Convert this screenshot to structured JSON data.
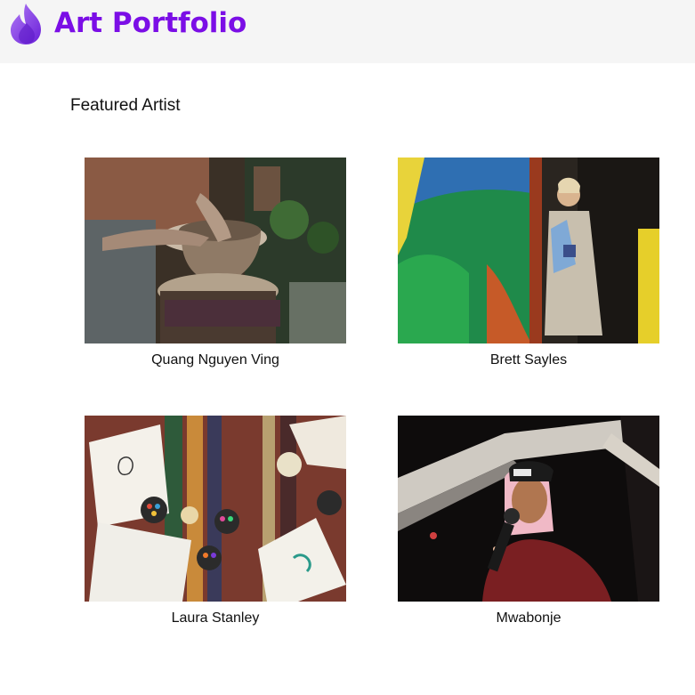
{
  "header": {
    "brand": "Art Portfolio",
    "logo_icon": "flame-icon",
    "brand_color": "#7b0ee6",
    "background": "#f5f5f5"
  },
  "section": {
    "title": "Featured Artist"
  },
  "artists": [
    {
      "name": "Quang Nguyen Ving"
    },
    {
      "name": "Brett Sayles"
    },
    {
      "name": "Laura Stanley"
    },
    {
      "name": "Mwabonje"
    }
  ]
}
